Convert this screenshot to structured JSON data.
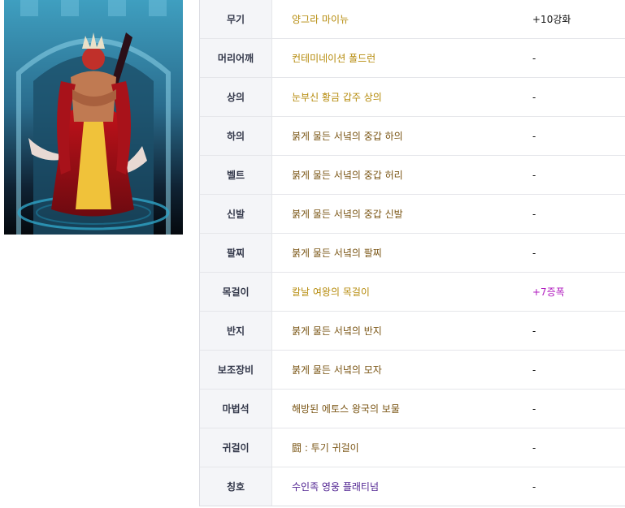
{
  "colors": {
    "unique": "#b58a0a",
    "epic": "#7a5514",
    "legendary": "#4d1f8f",
    "amplify": "#b01bbf"
  },
  "equipment": [
    {
      "slot": "무기",
      "item": "양그라 마이뉴",
      "item_color": "unique",
      "enhance": "+10강화",
      "enhance_color": "normal"
    },
    {
      "slot": "머리어깨",
      "item": "컨테미네이션 폴드런",
      "item_color": "unique",
      "enhance": "-",
      "enhance_color": "normal"
    },
    {
      "slot": "상의",
      "item": "눈부신 황금 갑주 상의",
      "item_color": "unique",
      "enhance": "-",
      "enhance_color": "normal"
    },
    {
      "slot": "하의",
      "item": "붉게 물든 서녘의 중갑 하의",
      "item_color": "epic",
      "enhance": "-",
      "enhance_color": "normal"
    },
    {
      "slot": "벨트",
      "item": "붉게 물든 서녘의 중갑 허리",
      "item_color": "epic",
      "enhance": "-",
      "enhance_color": "normal"
    },
    {
      "slot": "신발",
      "item": "붉게 물든 서녘의 중갑 신발",
      "item_color": "epic",
      "enhance": "-",
      "enhance_color": "normal"
    },
    {
      "slot": "팔찌",
      "item": "붉게 물든 서녘의 팔찌",
      "item_color": "epic",
      "enhance": "-",
      "enhance_color": "normal"
    },
    {
      "slot": "목걸이",
      "item": "칼날 여왕의 목걸이",
      "item_color": "unique",
      "enhance": "+7증폭",
      "enhance_color": "amplify"
    },
    {
      "slot": "반지",
      "item": "붉게 물든 서녘의 반지",
      "item_color": "epic",
      "enhance": "-",
      "enhance_color": "normal"
    },
    {
      "slot": "보조장비",
      "item": "붉게 물든 서녘의 모자",
      "item_color": "epic",
      "enhance": "-",
      "enhance_color": "normal"
    },
    {
      "slot": "마법석",
      "item": "해방된 에토스 왕국의 보물",
      "item_color": "epic",
      "enhance": "-",
      "enhance_color": "normal"
    },
    {
      "slot": "귀걸이",
      "item": "闘 : 투기 귀걸이",
      "item_color": "epic",
      "enhance": "-",
      "enhance_color": "normal"
    },
    {
      "slot": "칭호",
      "item": "수인족 영웅 플래티넘",
      "item_color": "legendary",
      "enhance": "-",
      "enhance_color": "normal"
    }
  ]
}
